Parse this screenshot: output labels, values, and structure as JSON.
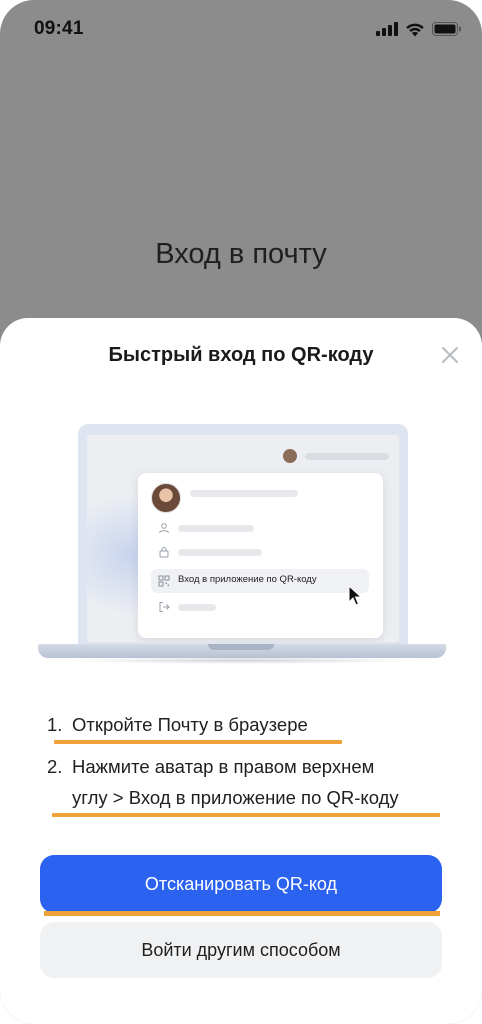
{
  "status_bar": {
    "time": "09:41",
    "icons": [
      "signal-icon",
      "wifi-icon",
      "battery-icon"
    ]
  },
  "background_screen": {
    "title": "Вход в почту"
  },
  "sheet": {
    "title": "Быстрый вход по QR-коду",
    "close_icon": "close-icon",
    "illustration": {
      "menu_item_label": "Вход в приложение по QR-коду"
    },
    "steps": [
      {
        "number": "1.",
        "text": "Откройте Почту в браузере"
      },
      {
        "number": "2.",
        "text_line1": "Нажмите аватар в правом верхнем",
        "text_line2": "углу > Вход в приложение по QR-коду"
      }
    ],
    "primary_button": "Отсканировать QR-код",
    "secondary_button": "Войти другим способом"
  },
  "colors": {
    "accent": "#2c62f0",
    "highlight_underline": "#f0a23a",
    "overlay": "#8c8c8c"
  }
}
